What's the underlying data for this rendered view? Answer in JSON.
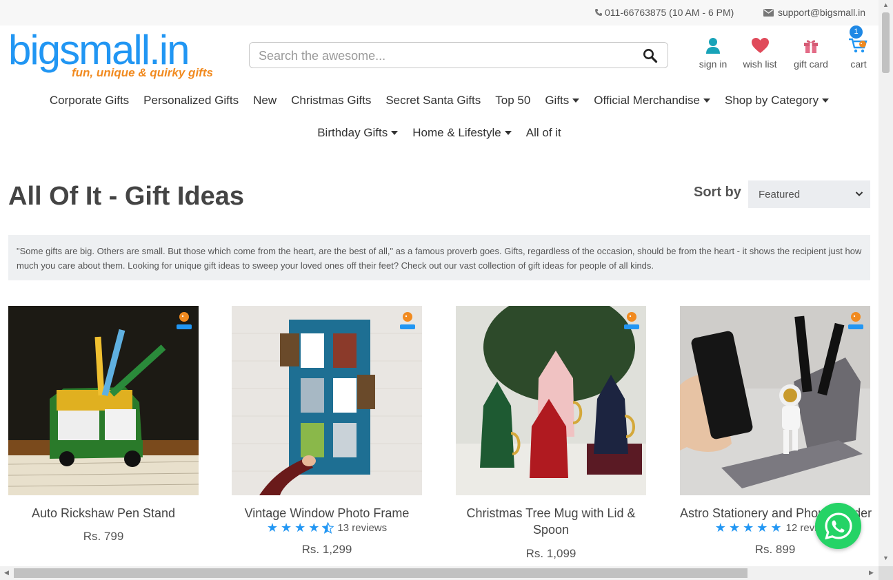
{
  "topbar": {
    "phone": "011-66763875 (10 AM - 6 PM)",
    "email": "support@bigsmall.in"
  },
  "logo": {
    "brand": "bigsmall.in",
    "tagline": "fun, unique & quirky gifts"
  },
  "search": {
    "placeholder": "Search the awesome..."
  },
  "account": {
    "sign_in": "sign in",
    "wish_list": "wish list",
    "gift_card": "gift card",
    "cart": "cart",
    "cart_count": "1"
  },
  "nav": {
    "row1": [
      {
        "label": "Corporate Gifts",
        "dropdown": false
      },
      {
        "label": "Personalized Gifts",
        "dropdown": false
      },
      {
        "label": "New",
        "dropdown": false
      },
      {
        "label": "Christmas Gifts",
        "dropdown": false
      },
      {
        "label": "Secret Santa Gifts",
        "dropdown": false
      },
      {
        "label": "Top 50",
        "dropdown": false
      },
      {
        "label": "Gifts",
        "dropdown": true
      },
      {
        "label": "Official Merchandise",
        "dropdown": true
      },
      {
        "label": "Shop by Category",
        "dropdown": true
      }
    ],
    "row2": [
      {
        "label": "Birthday Gifts",
        "dropdown": true
      },
      {
        "label": "Home & Lifestyle",
        "dropdown": true
      },
      {
        "label": "All of it",
        "dropdown": false
      }
    ]
  },
  "page": {
    "title": "All Of It - Gift Ideas",
    "sort_label": "Sort by",
    "sort_value": "Featured",
    "intro": "\"Some gifts are big. Others are small. But those which come from the heart, are the best of all,\" as a famous proverb goes. Gifts, regardless of the occasion, should be from the heart - it shows the recipient just how much you care about them. Looking for unique gift ideas to sweep your loved ones off their feet? Check out our vast collection of gift ideas for people of all kinds."
  },
  "products": [
    {
      "name": "Auto Rickshaw Pen Stand",
      "price": "Rs. 799",
      "rating": null,
      "reviews": null
    },
    {
      "name": "Vintage Window Photo Frame",
      "price": "Rs. 1,299",
      "rating": 4.5,
      "reviews": "13 reviews"
    },
    {
      "name": "Christmas Tree Mug with Lid & Spoon",
      "price": "Rs. 1,099",
      "rating": null,
      "reviews": null
    },
    {
      "name": "Astro Stationery and Phone Holder",
      "price": "Rs. 899",
      "rating": 5,
      "reviews": "12 reviews"
    }
  ],
  "colors": {
    "brand_blue": "#2196f3",
    "brand_orange": "#f18a1f",
    "whatsapp": "#25d366"
  }
}
